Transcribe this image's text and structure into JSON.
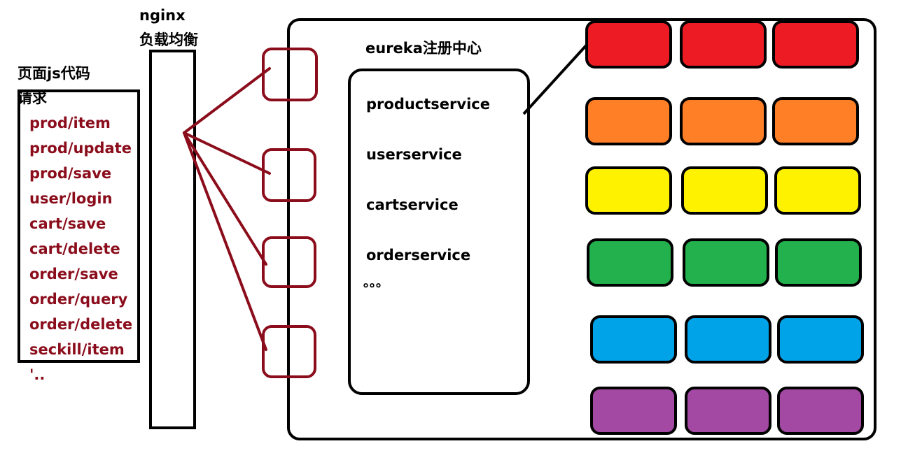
{
  "nginx": {
    "title": "nginx",
    "subtitle": "负载均衡"
  },
  "page": {
    "title_line1": "页面js代码",
    "title_line2": "请求"
  },
  "requests": [
    "prod/item",
    "prod/update",
    "prod/save",
    "user/login",
    "cart/save",
    "cart/delete",
    "order/save",
    "order/query",
    "order/delete",
    "seckill/item"
  ],
  "requests_more": "'..",
  "eureka": {
    "title": "eureka注册中心",
    "services": [
      "productservice",
      "userservice",
      "cartservice",
      "orderservice"
    ],
    "more": "。。。"
  },
  "colors": {
    "request_text": "#8b0d1c",
    "arrow": "#8b0d1c",
    "rows": [
      "#ed1c24",
      "#ff7f27",
      "#fff200",
      "#22b14c",
      "#00a2e8",
      "#a349a4"
    ]
  }
}
